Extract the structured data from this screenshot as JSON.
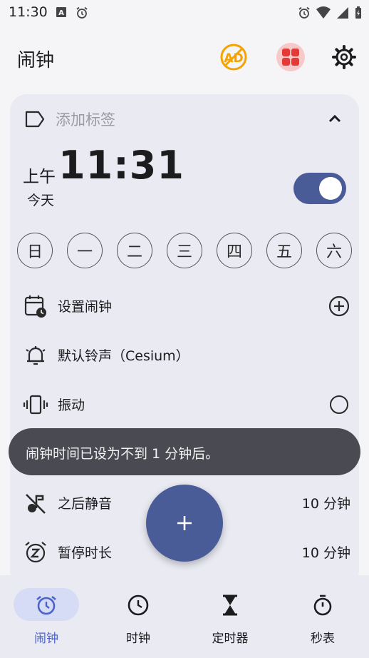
{
  "status_bar": {
    "time": "11:30"
  },
  "app_bar": {
    "title": "闹钟"
  },
  "alarm": {
    "label_placeholder": "添加标签",
    "ampm": "上午",
    "time": "11:31",
    "day_text": "今天",
    "enabled": true,
    "days": [
      "日",
      "一",
      "二",
      "三",
      "四",
      "五",
      "六"
    ],
    "options": {
      "set_alarm": "设置闹钟",
      "ringtone": "默认铃声（Cesium）",
      "vibrate": "振动",
      "silence_after_label": "之后静音",
      "silence_after_value": "10 分钟",
      "snooze_label": "暂停时长",
      "snooze_value": "10 分钟"
    }
  },
  "toast": {
    "text": "闹钟时间已设为不到 1 分钟后。"
  },
  "bottom_nav": {
    "items": [
      {
        "label": "闹钟",
        "icon": "alarm-icon",
        "active": true
      },
      {
        "label": "时钟",
        "icon": "clock-icon",
        "active": false
      },
      {
        "label": "定时器",
        "icon": "hourglass-icon",
        "active": false
      },
      {
        "label": "秒表",
        "icon": "stopwatch-icon",
        "active": false
      }
    ]
  },
  "colors": {
    "accent": "#4a5c97",
    "active": "#4a62c9",
    "ad": "#f5a300",
    "apps": "#e53935"
  }
}
